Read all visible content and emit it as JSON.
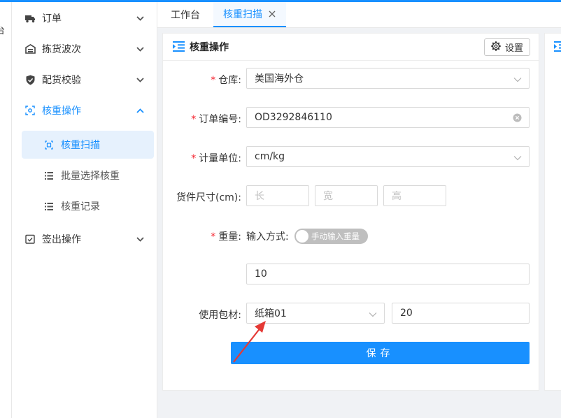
{
  "leftstrip": {
    "cut_text": "台"
  },
  "sidebar": {
    "items": [
      {
        "label": "订单",
        "icon": "truck-icon"
      },
      {
        "label": "拣货波次",
        "icon": "warehouse-icon"
      },
      {
        "label": "配货校验",
        "icon": "shield-check-icon"
      },
      {
        "label": "核重操作",
        "icon": "scan-icon",
        "expanded": true
      },
      {
        "label": "签出操作",
        "icon": "checkout-icon"
      }
    ],
    "subitems": [
      {
        "label": "核重扫描",
        "icon": "scan-doc-icon",
        "selected": true
      },
      {
        "label": "批量选择核重",
        "icon": "list-icon"
      },
      {
        "label": "核重记录",
        "icon": "list-icon"
      }
    ]
  },
  "tabs": [
    {
      "label": "工作台"
    },
    {
      "label": "核重扫描",
      "active": true
    }
  ],
  "panel": {
    "title": "核重操作",
    "settings_label": "设置"
  },
  "form": {
    "warehouse": {
      "label": "仓库:",
      "value": "美国海外仓"
    },
    "order_no": {
      "label": "订单编号:",
      "value": "OD3292846110"
    },
    "unit": {
      "label": "计量单位:",
      "value": "cm/kg"
    },
    "size": {
      "label": "货件尺寸(cm):",
      "length_placeholder": "长",
      "width_placeholder": "宽",
      "height_placeholder": "高"
    },
    "weight": {
      "label": "重量:",
      "mode_label": "输入方式:",
      "switch_text": "手动输入重量",
      "value": "10"
    },
    "packaging": {
      "label": "使用包材:",
      "value": "纸箱01",
      "qty": "20"
    },
    "save_label": "保存"
  },
  "colors": {
    "accent": "#1890ff",
    "required": "#f5222d",
    "annotation_arrow": "#e53935"
  }
}
